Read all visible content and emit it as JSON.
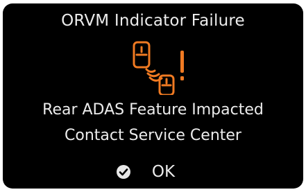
{
  "popup": {
    "title": "ORVM Indicator Failure",
    "icon": "orvm-warning-icon",
    "message_line1": "Rear ADAS Feature Impacted",
    "message_line2": "Contact Service Center",
    "ok_icon": "check-icon",
    "ok_label": "OK"
  },
  "colors": {
    "background": "#000000",
    "text": "#ececec",
    "warning": "#f07a22"
  }
}
